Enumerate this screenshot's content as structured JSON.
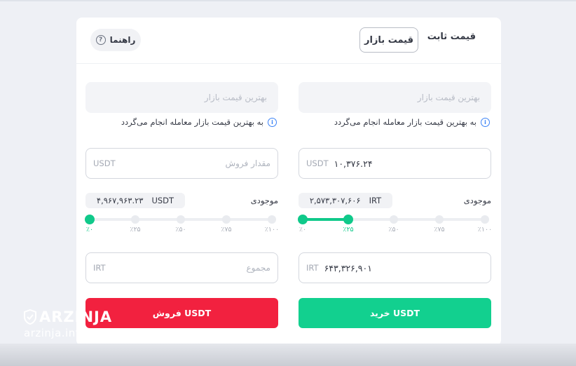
{
  "tabs": {
    "fixed_price": "قیمت ثابت",
    "market_price": "قیمت بازار"
  },
  "guide": {
    "label": "راهنما",
    "icon": "question-icon"
  },
  "buy": {
    "price_placeholder": "بهترین قیمت بازار",
    "hint": "به بهترین قیمت بازار معامله انجام می‌گردد",
    "amount_value": "۱۰,۳۷۶.۲۴",
    "amount_unit": "USDT",
    "balance_label": "موجودی",
    "balance_value": "۲,۵۷۳,۳۰۷,۶۰۶",
    "balance_unit": "IRT",
    "slider_percent": 25,
    "total_value": "۶۴۳,۳۲۶,۹۰۱",
    "total_unit": "IRT",
    "button_label": "خرید USDT"
  },
  "sell": {
    "price_placeholder": "بهترین قیمت بازار",
    "hint": "به بهترین قیمت بازار معامله انجام می‌گردد",
    "amount_placeholder": "مقدار فروش",
    "amount_unit": "USDT",
    "balance_label": "موجودی",
    "balance_value": "۴,۹۶۷,۹۶۳.۲۳",
    "balance_unit": "USDT",
    "slider_percent": 0,
    "total_placeholder": "مجموع",
    "total_unit": "IRT",
    "button_label": "فروش USDT"
  },
  "slider_ticks": [
    "٪۰",
    "٪۲۵",
    "٪۵۰",
    "٪۷۵",
    "٪۱۰۰"
  ],
  "colors": {
    "buy": "#12d08f",
    "sell": "#f2213f",
    "slider": "#10c98a",
    "info": "#3b82f6"
  },
  "watermark": {
    "logo": "ARZINJA",
    "url": "arzinja.info"
  }
}
